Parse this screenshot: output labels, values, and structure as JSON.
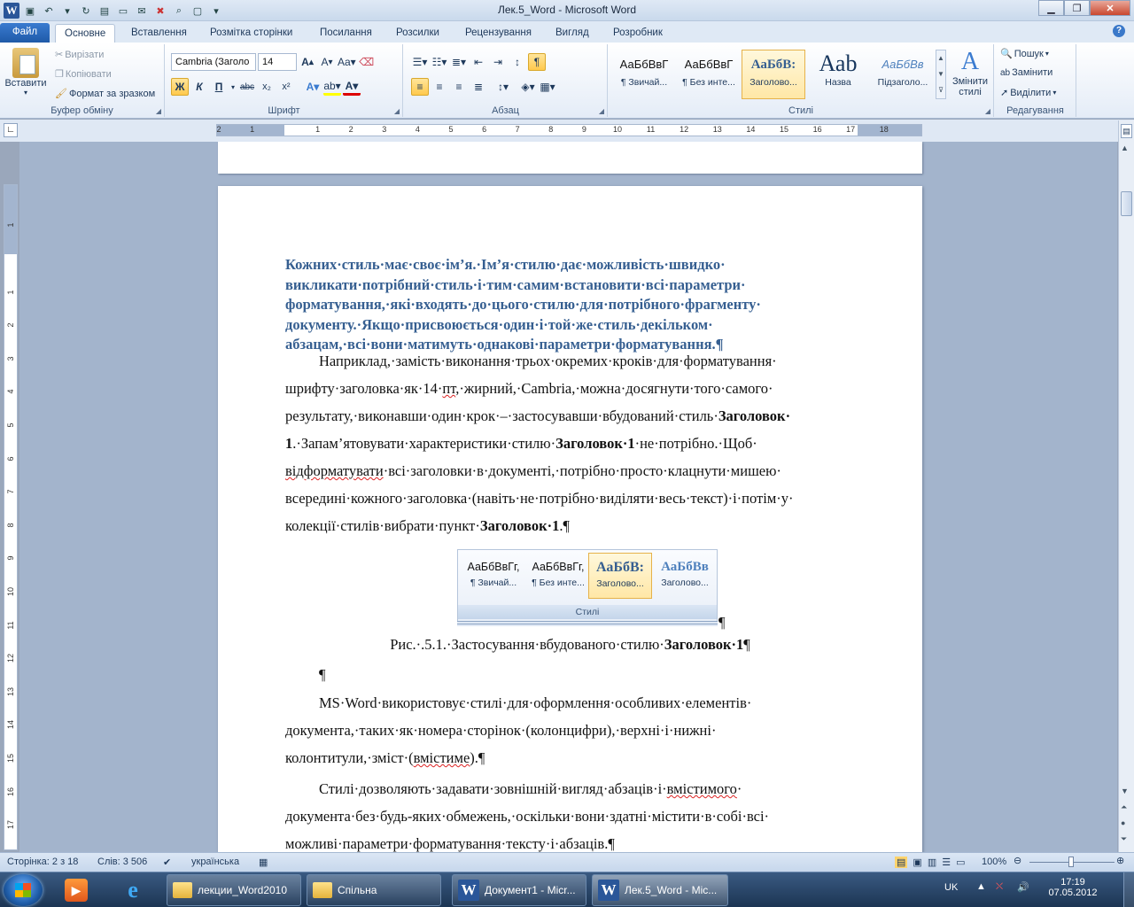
{
  "window": {
    "title": "Лек.5_Word  -  Microsoft Word"
  },
  "qat": {
    "icons": [
      "word-logo-icon",
      "save-icon",
      "undo-icon",
      "redo-icon",
      "print-preview-icon",
      "open-icon",
      "email-icon",
      "close-doc-icon",
      "zoom-icon",
      "blank-icon"
    ]
  },
  "tabs": [
    {
      "label": "Файл"
    },
    {
      "label": "Основне"
    },
    {
      "label": "Вставлення"
    },
    {
      "label": "Розмітка сторінки"
    },
    {
      "label": "Посилання"
    },
    {
      "label": "Розсилки"
    },
    {
      "label": "Рецензування"
    },
    {
      "label": "Вигляд"
    },
    {
      "label": "Розробник"
    }
  ],
  "ribbon": {
    "clipboard": {
      "paste": "Вставити",
      "cut": "Вирізати",
      "copy": "Копіювати",
      "format_painter": "Формат за зразком",
      "label": "Буфер обміну"
    },
    "font": {
      "name": "Cambria (Заголо",
      "size": "14",
      "label": "Шрифт",
      "bold": "Ж",
      "italic": "К",
      "underline": "П",
      "strike": "abc",
      "sub": "x₂",
      "sup": "x²"
    },
    "paragraph": {
      "label": "Абзац"
    },
    "styles": {
      "label": "Стилі",
      "items": [
        {
          "preview": "АаБбВвГ",
          "name": "¶ Звичай..."
        },
        {
          "preview": "АаБбВвГ",
          "name": "¶ Без инте..."
        },
        {
          "preview": "АаБбВ:",
          "name": "Заголово..."
        },
        {
          "preview": "Ааb",
          "name": "Назва"
        },
        {
          "preview": "АаБбВв",
          "name": "Підзаголо..."
        }
      ],
      "change": "Змінити стилі"
    },
    "editing": {
      "find": "Пошук",
      "replace": "Замінити",
      "select": "Виділити",
      "label": "Редагування"
    }
  },
  "ruler": {
    "h_labels": [
      "2",
      "1",
      "1",
      "2",
      "3",
      "4",
      "5",
      "6",
      "7",
      "8",
      "9",
      "10",
      "11",
      "12",
      "13",
      "14",
      "15",
      "16",
      "17",
      "18"
    ],
    "v_labels": [
      "1",
      "1",
      "2",
      "3",
      "4",
      "5",
      "6",
      "7",
      "8",
      "9",
      "10",
      "11",
      "12",
      "13",
      "14",
      "15",
      "16",
      "17"
    ]
  },
  "document": {
    "heading": "Кожних·стиль·має·своє·ім’я.·Ім’я·стилю·дає·можливість·швидко· викликати·потрібний·стиль·і·тим·самим·встановити·всі·параметри· форматування,·які·входять·до·цього·стилю·для·потрібного·фрагменту· документу.·Якщо·присвоюється·один·і·той·же·стиль·декільком· абзацам,·всі·вони·матимуть·однакові·параметри·форматування.¶",
    "para1_a": "Наприклад,·замість·виконання·трьох·окремих·кроків·для·форматування· шрифту·заголовка·як·14·",
    "para1_pt": "пт",
    "para1_b": ",·жирний,·Cambria,·можна·досягнути·того·самого· результату,·виконавши·один·крок·–·застосувавши·вбудований·стиль·",
    "para1_bold1": "Заголовок· 1",
    "para1_c": ".·Запам’ятовувати·характеристики·стилю·",
    "para1_bold2": "Заголовок·1",
    "para1_d": "·не·потрібно.·Щоб· ",
    "para1_squig": "відформатувати",
    "para1_e": "·всі·заголовки·в·документі,·потрібно·просто·клацнути·мишею· всередині·кожного·заголовка·(навіть·не·потрібно·виділяти·весь·текст)·і·потім·у· колекції·стилів·вибрати·пункт·",
    "para1_bold3": "Заголовок·1",
    "para1_end": ".¶",
    "figure": {
      "items": [
        {
          "preview": "АаБбВвГг,",
          "name": "¶ Звичай..."
        },
        {
          "preview": "АаБбВвГг,",
          "name": "¶ Без инте..."
        },
        {
          "preview": "АаБбВ:",
          "name": "Заголово..."
        },
        {
          "preview": "АаБбВв",
          "name": "Заголово..."
        }
      ],
      "label": "Стилі",
      "pilcrow": "¶"
    },
    "caption_a": "Рис.·.5.1.·Застосування·вбудованого·стилю·",
    "caption_bold": "Заголовок·1",
    "caption_end": "¶",
    "empty_para": "¶",
    "para2": "MS·Word·використовує·стилі·для·оформлення·особливих·елементів· документа,·таких·як·номера·сторінок·(колонцифри),·верхні·і·нижні· колонтитули,·зміст·(",
    "para2_squig": "вмістиме",
    "para2_end": ").¶",
    "para3_a": "Стилі·дозволяють·задавати·зовнішній·вигляд·абзаців·і·",
    "para3_squig": "вмістимого",
    "para3_b": "· документа·без·будь-яких·обмежень,·оскільки·вони·здатні·містити·в·собі·всі· можливі·параметри·форматування·тексту·і·абзаців.¶"
  },
  "status": {
    "page": "Сторінка: 2 з 18",
    "words": "Слів: 3 506",
    "lang": "українська",
    "zoom": "100%"
  },
  "taskbar": {
    "tasks": [
      {
        "label": "лекции_Word2010"
      },
      {
        "label": "Спільна"
      },
      {
        "label": "Документ1 - Micr..."
      },
      {
        "label": "Лек.5_Word - Mic..."
      }
    ],
    "lang": "UK",
    "time": "17:19",
    "date": "07.05.2012"
  }
}
